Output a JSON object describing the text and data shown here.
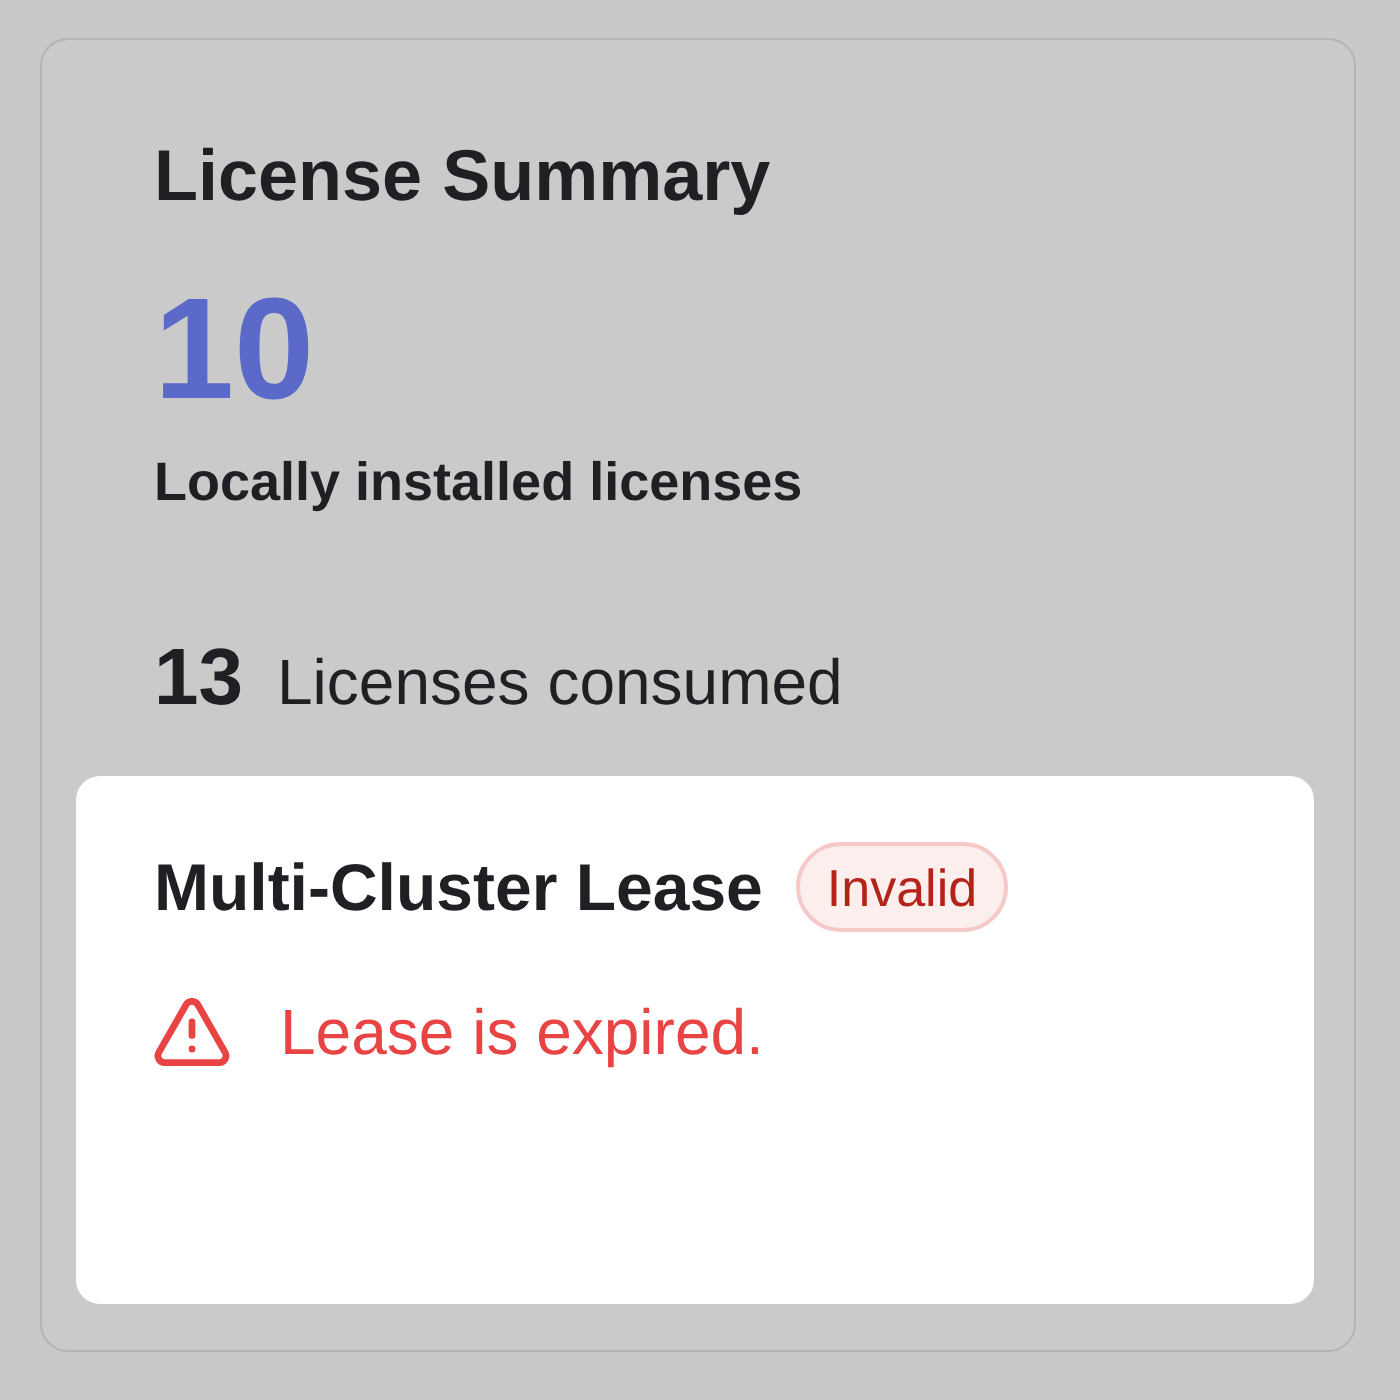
{
  "card": {
    "title": "License Summary",
    "installed": {
      "count": "10",
      "label": "Locally installed licenses"
    },
    "consumed": {
      "count": "13",
      "label": "Licenses consumed"
    }
  },
  "lease": {
    "title": "Multi-Cluster Lease",
    "badge": {
      "label": "Invalid",
      "kind": "error"
    },
    "alert": {
      "kind": "warning",
      "text": "Lease is expired."
    }
  }
}
